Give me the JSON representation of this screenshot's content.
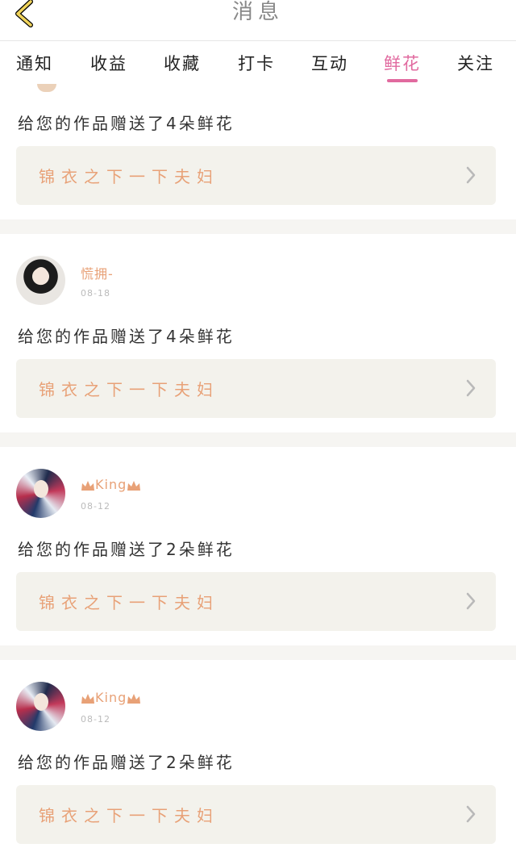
{
  "header": {
    "title": "消息"
  },
  "tabs": [
    {
      "label": "通知"
    },
    {
      "label": "收益"
    },
    {
      "label": "收藏"
    },
    {
      "label": "打卡"
    },
    {
      "label": "互动"
    },
    {
      "label": "鲜花",
      "active": true
    },
    {
      "label": "关注"
    }
  ],
  "colors": {
    "accent": "#e16a9f",
    "title_orange": "#e8a177",
    "card_bg": "#f3f2ec"
  },
  "messages": [
    {
      "text": "给您的作品赠送了4朵鲜花",
      "work_title": "锦衣之下一下夫妇"
    },
    {
      "user": "慌拥-",
      "date": "08-18",
      "text": "给您的作品赠送了4朵鲜花",
      "work_title": "锦衣之下一下夫妇"
    },
    {
      "user": "King",
      "date": "08-12",
      "text": "给您的作品赠送了2朵鲜花",
      "work_title": "锦衣之下一下夫妇"
    },
    {
      "user": "King",
      "date": "08-12",
      "text": "给您的作品赠送了2朵鲜花",
      "work_title": "锦衣之下一下夫妇"
    }
  ],
  "icons": {
    "back": "chevron-left-icon",
    "card_arrow": "chevron-right-icon",
    "crown": "crown-icon"
  }
}
